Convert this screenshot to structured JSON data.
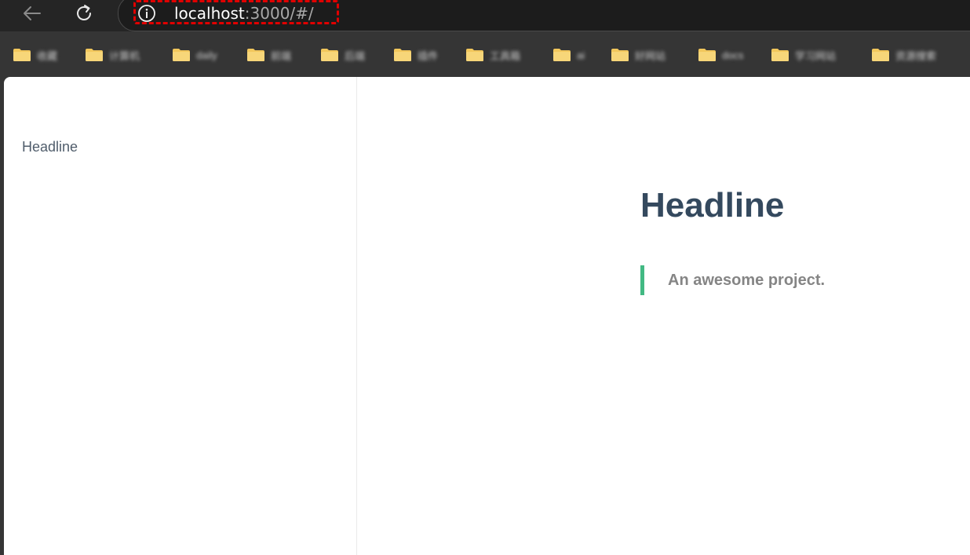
{
  "browser": {
    "url_host": "localhost",
    "url_rest": ":3000/#/",
    "bookmarks": [
      {
        "label": "收藏"
      },
      {
        "label": "计算机"
      },
      {
        "label": "daily"
      },
      {
        "label": "前端"
      },
      {
        "label": "后端"
      },
      {
        "label": "插件"
      },
      {
        "label": "工具箱"
      },
      {
        "label": "ai"
      },
      {
        "label": "好网站"
      },
      {
        "label": "docs"
      },
      {
        "label": "学习网站"
      },
      {
        "label": "资源搜索"
      }
    ]
  },
  "sidebar": {
    "items": [
      {
        "label": "Headline"
      }
    ]
  },
  "main": {
    "title": "Headline",
    "quote": "An awesome project."
  },
  "colors": {
    "accent": "#42b983",
    "heading": "#34495e",
    "highlight": "#e00000"
  }
}
